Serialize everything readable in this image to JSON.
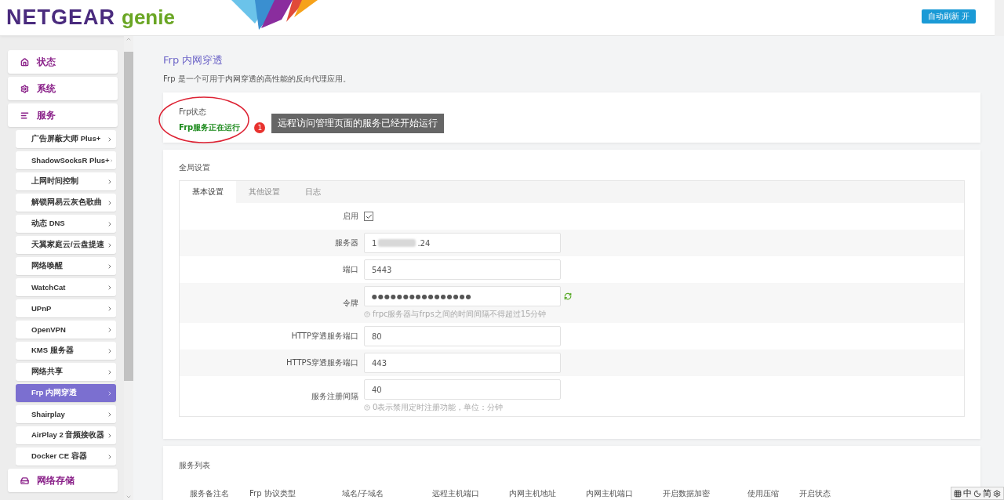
{
  "header": {
    "logo_main": "NETGEAR",
    "logo_sub": "genie",
    "auto_refresh": "自动刷新 开"
  },
  "sidebar": {
    "items": [
      {
        "label": "状态",
        "selected": false
      },
      {
        "label": "系统",
        "selected": false
      },
      {
        "label": "服务",
        "selected": false,
        "children": [
          {
            "label": "广告屏蔽大师 Plus+",
            "selected": false
          },
          {
            "label": "ShadowSocksR Plus+",
            "selected": false
          },
          {
            "label": "上网时间控制",
            "selected": false
          },
          {
            "label": "解锁网易云灰色歌曲",
            "selected": false
          },
          {
            "label": "动态 DNS",
            "selected": false
          },
          {
            "label": "天翼家庭云/云盘提速",
            "selected": false
          },
          {
            "label": "网络唤醒",
            "selected": false
          },
          {
            "label": "WatchCat",
            "selected": false
          },
          {
            "label": "UPnP",
            "selected": false
          },
          {
            "label": "OpenVPN",
            "selected": false
          },
          {
            "label": "KMS 服务器",
            "selected": false
          },
          {
            "label": "网络共享",
            "selected": false
          },
          {
            "label": "Frp 内网穿透",
            "selected": true
          },
          {
            "label": "Shairplay",
            "selected": false
          },
          {
            "label": "AirPlay 2 音频接收器",
            "selected": false
          },
          {
            "label": "Docker CE 容器",
            "selected": false
          }
        ]
      },
      {
        "label": "网络存储",
        "selected": false
      }
    ]
  },
  "page": {
    "title": "Frp 内网穿透",
    "description": "Frp 是一个可用于内网穿透的高性能的反向代理应用。"
  },
  "status": {
    "label": "Frp状态",
    "value": "Frp服务正在运行",
    "running": true,
    "annotation": {
      "number": "1",
      "text": "远程访问管理页面的服务已经开始运行"
    }
  },
  "settings": {
    "title": "全局设置",
    "tabs": [
      {
        "label": "基本设置",
        "selected": true
      },
      {
        "label": "其他设置",
        "selected": false
      },
      {
        "label": "日志",
        "selected": false
      }
    ],
    "fields": [
      {
        "kind": "checkbox",
        "label": "启用",
        "checked": true
      },
      {
        "kind": "redacted",
        "label": "服务器",
        "value_start": "1",
        "value_end": ".24"
      },
      {
        "kind": "text",
        "label": "端口",
        "value": "5443"
      },
      {
        "kind": "password",
        "label": "令牌",
        "value": "●●●●●●●●●●●●●●●●",
        "hint": "frpc服务器与frps之间的时间间隔不得超过15分钟"
      },
      {
        "kind": "text",
        "label": "HTTP穿透服务端口",
        "value": "80"
      },
      {
        "kind": "text",
        "label": "HTTPS穿透服务端口",
        "value": "443"
      },
      {
        "kind": "text",
        "label": "服务注册间隔",
        "value": "40",
        "hint": "0表示禁用定时注册功能，单位：分钟"
      }
    ]
  },
  "service_list": {
    "title": "服务列表",
    "columns": [
      "服务备注名",
      "Frp 协议类型",
      "域名/子域名",
      "远程主机端口",
      "内网主机地址",
      "内网主机端口",
      "开启数据加密",
      "使用压缩",
      "开启状态"
    ]
  },
  "ime_bar": {
    "items": [
      "中",
      "简"
    ]
  }
}
